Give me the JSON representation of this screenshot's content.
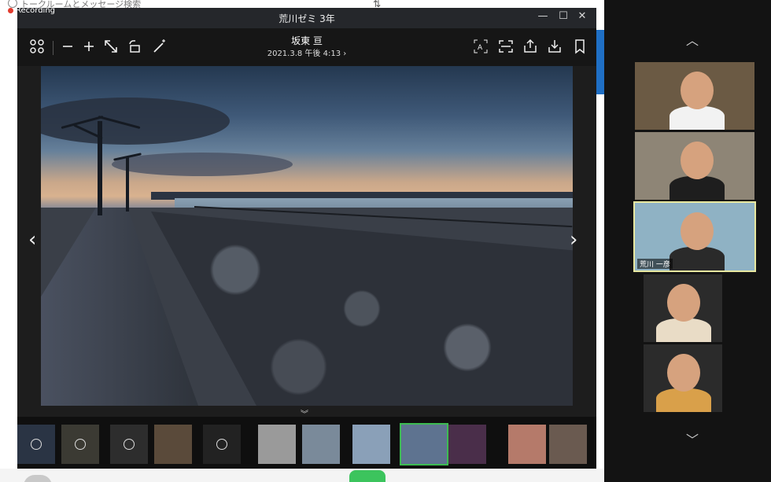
{
  "recording": {
    "label": "Recording"
  },
  "background_app": {
    "search_placeholder": "トークルームとメッセージ検索",
    "sort_icon": "sort-icon"
  },
  "viewer": {
    "window_title": "荒川ゼミ 3年",
    "window_controls": [
      "minimize-icon",
      "maximize-icon",
      "close-icon"
    ],
    "sender_name": "坂東 亘",
    "sent_time": "2021.3.8 午後 4:13",
    "toolbar_left": [
      "grid-icon",
      "zoom-out-icon",
      "zoom-in-icon",
      "fit-icon",
      "rotate-icon",
      "magic-wand-icon"
    ],
    "toolbar_right": [
      "text-recognition-icon",
      "capture-icon",
      "share-icon",
      "download-icon",
      "bookmark-icon"
    ],
    "prev_icon": "chevron-left-icon",
    "next_icon": "chevron-right-icon",
    "strip_toggle_icon": "chevron-double-down-icon",
    "thumbnails": [
      {
        "name": "thumb-1",
        "type": "video",
        "color": "#2a3444"
      },
      {
        "name": "thumb-2",
        "type": "video",
        "color": "#3b3a33"
      },
      {
        "name": "thumb-3",
        "type": "video",
        "color": "#2d2d2d"
      },
      {
        "name": "thumb-4",
        "type": "image",
        "color": "#5a4a3a"
      },
      {
        "name": "thumb-5",
        "type": "video",
        "color": "#222"
      },
      {
        "name": "thumb-6",
        "type": "image",
        "color": "#9a9a9a"
      },
      {
        "name": "thumb-7",
        "type": "image",
        "color": "#7a8a9a"
      },
      {
        "name": "thumb-8",
        "type": "image",
        "color": "#8aa0b8"
      },
      {
        "name": "thumb-9",
        "type": "image",
        "color": "#5e7390",
        "selected": true
      },
      {
        "name": "thumb-10",
        "type": "image",
        "color": "#4a2e4a"
      },
      {
        "name": "thumb-11",
        "type": "image",
        "color": "#b57a6a"
      },
      {
        "name": "thumb-12",
        "type": "image",
        "color": "#6a5a50"
      }
    ]
  },
  "zoom_gallery": {
    "up_icon": "chevron-up-icon",
    "down_icon": "chevron-down-icon",
    "participants": [
      {
        "name": "",
        "bg": "#6b5a44",
        "shirt": "#f2f2f2"
      },
      {
        "name": "",
        "bg": "#8e8576",
        "shirt": "#1e1e1e"
      },
      {
        "name": "荒川 一彦",
        "bg": "#8fb2c4",
        "shirt": "#2a2a2a",
        "active": true
      },
      {
        "name": "",
        "bg": "#3a3a3a",
        "shirt": "#e9dcc6"
      },
      {
        "name": "",
        "bg": "#c7c2b3",
        "shirt": "#d9a04a"
      }
    ]
  }
}
